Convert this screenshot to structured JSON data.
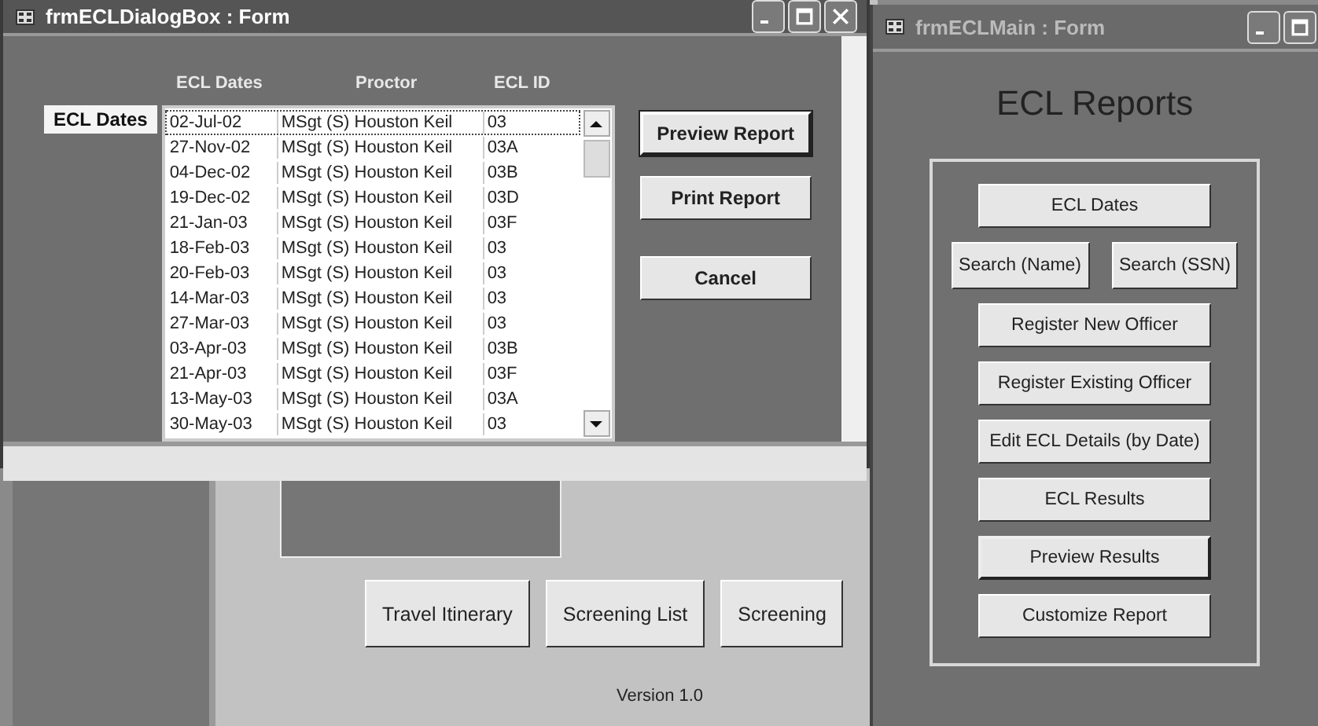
{
  "background_form": {
    "buttons": [
      {
        "label": "Travel Itinerary"
      },
      {
        "label": "Screening List"
      },
      {
        "label": "Screening"
      }
    ],
    "version": "Version 1.0"
  },
  "dialog": {
    "title": "frmECLDialogBox : Form",
    "active": true,
    "field_label": "ECL Dates",
    "columns": [
      "ECL Dates",
      "Proctor",
      "ECL ID"
    ],
    "rows": [
      {
        "cells": [
          "02-Jul-02",
          "MSgt (S) Houston Keil",
          "03"
        ],
        "selected": true
      },
      {
        "cells": [
          "27-Nov-02",
          "MSgt (S) Houston Keil",
          "03A"
        ],
        "selected": false
      },
      {
        "cells": [
          "04-Dec-02",
          "MSgt (S) Houston Keil",
          "03B"
        ],
        "selected": false
      },
      {
        "cells": [
          "19-Dec-02",
          "MSgt (S) Houston Keil",
          "03D"
        ],
        "selected": false
      },
      {
        "cells": [
          "21-Jan-03",
          "MSgt (S) Houston Keil",
          "03F"
        ],
        "selected": false
      },
      {
        "cells": [
          "18-Feb-03",
          "MSgt (S) Houston Keil",
          "03"
        ],
        "selected": false
      },
      {
        "cells": [
          "20-Feb-03",
          "MSgt (S) Houston Keil",
          "03"
        ],
        "selected": false
      },
      {
        "cells": [
          "14-Mar-03",
          "MSgt (S) Houston Keil",
          "03"
        ],
        "selected": false
      },
      {
        "cells": [
          "27-Mar-03",
          "MSgt (S) Houston Keil",
          "03"
        ],
        "selected": false
      },
      {
        "cells": [
          "03-Apr-03",
          "MSgt (S) Houston Keil",
          "03B"
        ],
        "selected": false
      },
      {
        "cells": [
          "21-Apr-03",
          "MSgt (S) Houston Keil",
          "03F"
        ],
        "selected": false
      },
      {
        "cells": [
          "13-May-03",
          "MSgt (S) Houston Keil",
          "03A"
        ],
        "selected": false
      },
      {
        "cells": [
          "30-May-03",
          "MSgt (S) Houston Keil",
          "03"
        ],
        "selected": false
      }
    ],
    "buttons": [
      {
        "label": "Preview Report",
        "focused": true
      },
      {
        "label": "Print Report",
        "focused": false
      },
      {
        "label": "Cancel",
        "focused": false
      }
    ]
  },
  "main": {
    "title": "frmECLMain : Form",
    "active": false,
    "heading": "ECL Reports",
    "buttons": [
      {
        "label": "ECL Dates",
        "kind": "wide",
        "focused": false
      },
      {
        "label": "Search (Name)",
        "kind": "pair",
        "focused": false
      },
      {
        "label": "Search (SSN)",
        "kind": "pair",
        "focused": false
      },
      {
        "label": "Register New Officer",
        "kind": "wide",
        "focused": false
      },
      {
        "label": "Register Existing Officer",
        "kind": "wide",
        "focused": false
      },
      {
        "label": "Edit ECL Details (by Date)",
        "kind": "wide",
        "focused": false
      },
      {
        "label": "ECL Results",
        "kind": "wide",
        "focused": false
      },
      {
        "label": "Preview Results",
        "kind": "wide",
        "focused": true
      },
      {
        "label": "Customize Report",
        "kind": "wide",
        "focused": false
      }
    ]
  }
}
